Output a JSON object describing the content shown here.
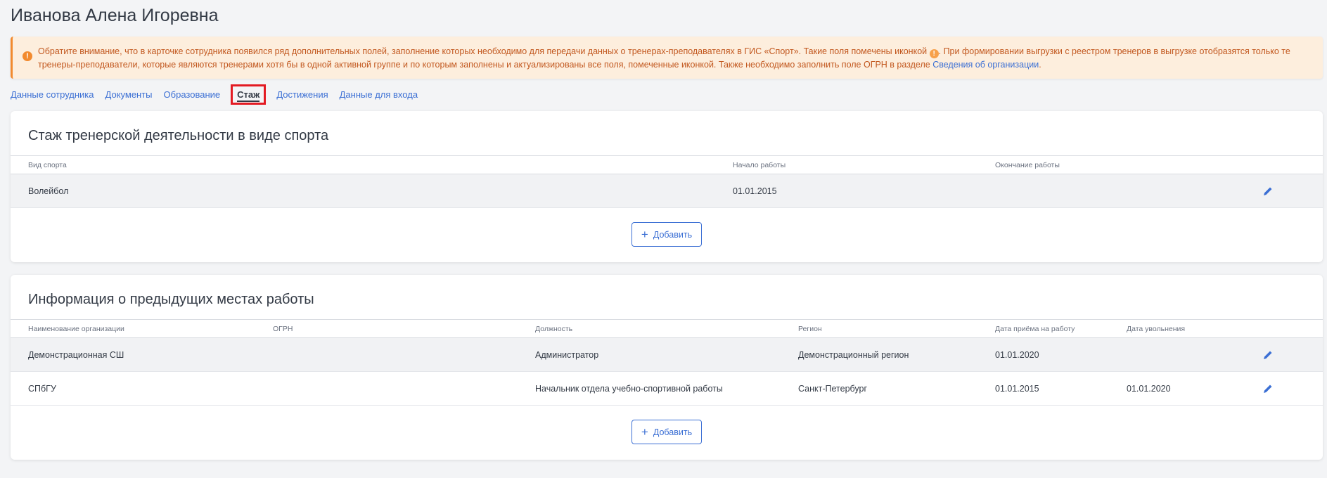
{
  "page": {
    "title": "Иванова Алена Игоревна"
  },
  "alert": {
    "text_part1": "Обратите внимание, что в карточке сотрудника появился ряд дополнительных полей, заполнение которых необходимо для передачи данных о тренерах-преподавателях в ГИС «Спорт». Такие поля помечены иконкой",
    "text_part2": ". При формировании выгрузки с реестром тренеров в выгрузке отобразятся только те тренеры-преподаватели, которые являются тренерами хотя бы в одной активной группе и по которым заполнены и актуализированы все поля, помеченные иконкой. Также необходимо заполнить поле ОГРН в разделе",
    "link": "Сведения об организации",
    "text_part3": ".",
    "icon_glyph": "!"
  },
  "tabs": [
    {
      "label": "Данные сотрудника"
    },
    {
      "label": "Документы"
    },
    {
      "label": "Образование"
    },
    {
      "label": "Стаж",
      "active": true
    },
    {
      "label": "Достижения"
    },
    {
      "label": "Данные для входа"
    }
  ],
  "experience": {
    "title": "Стаж тренерской деятельности в виде спорта",
    "columns": [
      "Вид спорта",
      "Начало работы",
      "Окончание работы"
    ],
    "rows": [
      {
        "sport": "Волейбол",
        "start": "01.01.2015",
        "end": ""
      }
    ],
    "add_label": "Добавить"
  },
  "prev_jobs": {
    "title": "Информация о предыдущих местах работы",
    "columns": [
      "Наименование организации",
      "ОГРН",
      "Должность",
      "Регион",
      "Дата приёма на работу",
      "Дата увольнения"
    ],
    "rows": [
      {
        "org": "Демонстрационная СШ",
        "ogrn": "",
        "position": "Администратор",
        "region": "Демонстрационный регион",
        "hired": "01.01.2020",
        "fired": ""
      },
      {
        "org": "СПбГУ",
        "ogrn": "",
        "position": "Начальник отдела учебно-спортивной работы",
        "region": "Санкт-Петербург",
        "hired": "01.01.2015",
        "fired": "01.01.2020"
      }
    ],
    "add_label": "Добавить"
  },
  "colors": {
    "accent": "#3b6fd4",
    "warning": "#f28a2e",
    "highlight": "#e31b23"
  },
  "icons": {
    "edit": "pencil-icon",
    "add": "plus-icon",
    "warning": "warning-icon"
  }
}
